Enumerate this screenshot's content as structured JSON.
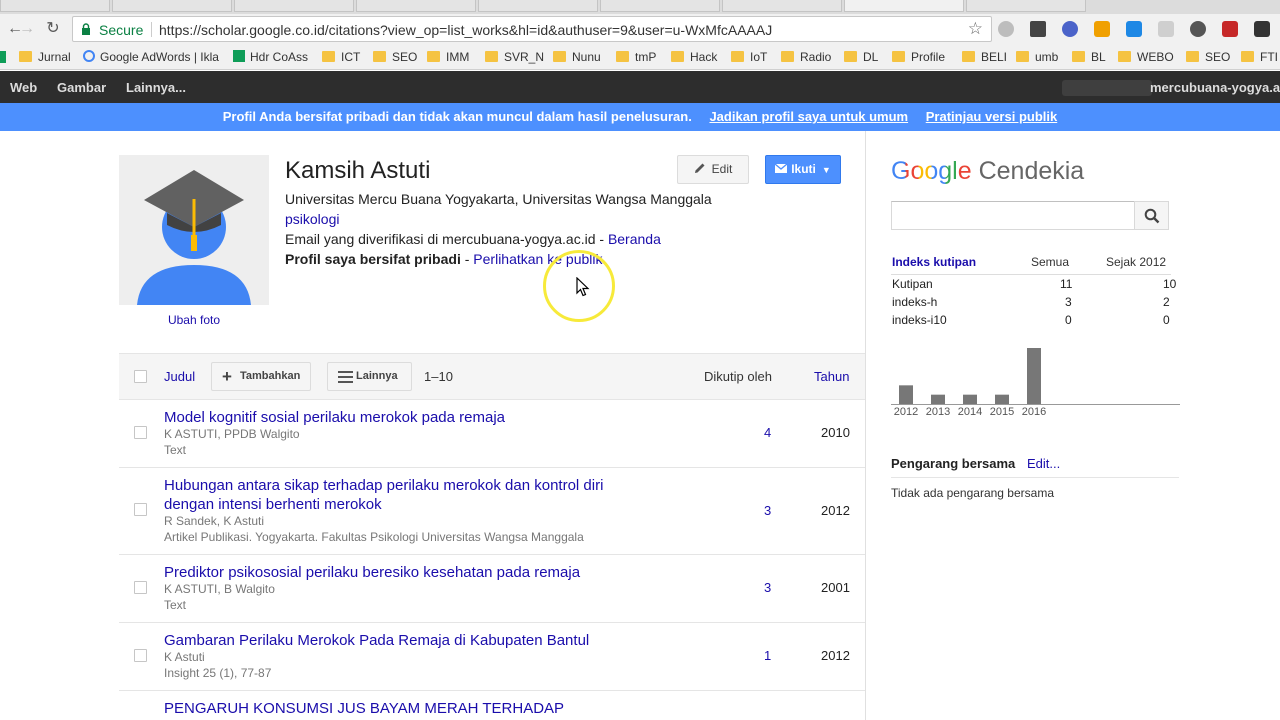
{
  "browser": {
    "secure_label": "Secure",
    "url": "https://scholar.google.co.id/citations?view_op=list_works&hl=id&authuser=9&user=u-WxMfcAAAAJ",
    "bookmarks": [
      "Jurnal",
      "Google AdWords | Ikla",
      "Hdr CoAss",
      "ICT",
      "SEO",
      "IMM",
      "SVR_N",
      "Nunu",
      "tmP",
      "Hack",
      "IoT",
      "Radio",
      "DL",
      "Profile",
      "BELI",
      "umb",
      "BL",
      "WEBO",
      "SEO",
      "FTI"
    ]
  },
  "gbar": {
    "items": [
      "Web",
      "Gambar",
      "Lainnya..."
    ],
    "domain": "mercubuana-yogya.ac"
  },
  "banner": {
    "text": "Profil Anda bersifat pribadi dan tidak akan muncul dalam hasil penelusuran.",
    "link1": "Jadikan profil saya untuk umum",
    "link2": "Pratinjau versi publik"
  },
  "profile": {
    "name": "Kamsih Astuti",
    "affiliation": "Universitas Mercu Buana Yogyakarta, Universitas Wangsa Manggala",
    "interest": "psikologi",
    "email_text": "Email yang diverifikasi di mercubuana-yogya.ac.id - ",
    "homepage": "Beranda",
    "privacy_bold": "Profil saya bersifat pribadi",
    "privacy_sep": " - ",
    "privacy_link": "Perlihatkan ke publik",
    "change_photo": "Ubah foto",
    "edit_label": "Edit",
    "follow_label": "Ikuti"
  },
  "table": {
    "col_title": "Judul",
    "add_label": "Tambahkan",
    "more_label": "Lainnya",
    "range": "1–10",
    "col_cited": "Dikutip oleh",
    "col_year": "Tahun",
    "rows": [
      {
        "title": "Model kognitif sosial perilaku merokok pada remaja",
        "authors": "K ASTUTI, PPDB Walgito",
        "source": "Text",
        "cites": "4",
        "year": "2010"
      },
      {
        "title": "Hubungan antara sikap terhadap perilaku merokok dan kontrol diri dengan intensi berhenti merokok",
        "authors": "R Sandek, K Astuti",
        "source": "Artikel Publikasi. Yogyakarta. Fakultas Psikologi Universitas Wangsa Manggala",
        "cites": "3",
        "year": "2012"
      },
      {
        "title": "Prediktor psikososial perilaku beresiko kesehatan pada remaja",
        "authors": "K ASTUTI, B Walgito",
        "source": "Text",
        "cites": "3",
        "year": "2001"
      },
      {
        "title": "Gambaran Perilaku Merokok Pada Remaja di Kabupaten Bantul",
        "authors": "K Astuti",
        "source": "Insight 25 (1), 77-87",
        "cites": "1",
        "year": "2012"
      },
      {
        "title": "PENGARUH KONSUMSI JUS BAYAM MERAH TERHADAP",
        "authors": "",
        "source": "",
        "cites": "",
        "year": ""
      }
    ]
  },
  "sidebar": {
    "logo_google": "Google",
    "logo_cendekia": "Cendekia",
    "citations": {
      "heading": "Indeks kutipan",
      "col_all": "Semua",
      "col_since": "Sejak 2012",
      "rows": [
        {
          "label": "Kutipan",
          "all": "11",
          "since": "10"
        },
        {
          "label": "indeks-h",
          "all": "3",
          "since": "2"
        },
        {
          "label": "indeks-i10",
          "all": "0",
          "since": "0"
        }
      ]
    },
    "coauthors_heading": "Pengarang bersama",
    "coauthors_edit": "Edit...",
    "coauthors_none": "Tidak ada pengarang bersama"
  },
  "chart_data": {
    "type": "bar",
    "categories": [
      "2012",
      "2013",
      "2014",
      "2015",
      "2016"
    ],
    "values": [
      2,
      1,
      1,
      1,
      6
    ],
    "ylim": [
      0,
      6
    ],
    "grid": false,
    "bar_color": "#777777"
  }
}
